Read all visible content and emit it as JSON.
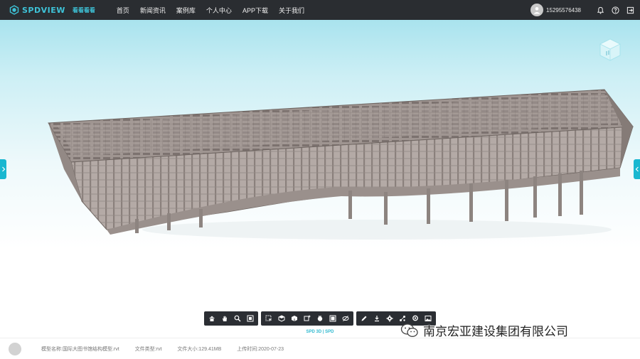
{
  "header": {
    "brand": "SPDVIEW",
    "brand_sub": "看看看看",
    "nav": [
      "首页",
      "新闻资讯",
      "案例库",
      "个人中心",
      "APP下载",
      "关于我们"
    ],
    "phone": "15295576438"
  },
  "colors": {
    "accent": "#19b7d0",
    "topbar": "#2a2d31",
    "toolbar": "#2b2e33"
  },
  "toolbar": {
    "groups": [
      [
        "home-icon",
        "pan-hand-icon",
        "zoom-icon",
        "fit-view-icon"
      ],
      [
        "select-box-icon",
        "cube-icon",
        "section-cube-icon",
        "box-add-icon",
        "hand-icon",
        "properties-icon",
        "hide-icon"
      ],
      [
        "pencil-icon",
        "measure-icon",
        "settings-icon",
        "explode-icon",
        "locate-icon",
        "image-icon"
      ]
    ],
    "brand_mini": "SPD 3D | SPD"
  },
  "watermark": {
    "text": "南京宏亚建设集团有限公司"
  },
  "info": {
    "model_name_label": "模型名称:",
    "model_name": "国际大图书馆结构模型.rvt",
    "file_type_label": "文件类型:",
    "file_type": "rvt",
    "file_size_label": "文件大小:",
    "file_size": "129.41MB",
    "upload_time_label": "上传时间:",
    "upload_time": "2020-07-23"
  }
}
